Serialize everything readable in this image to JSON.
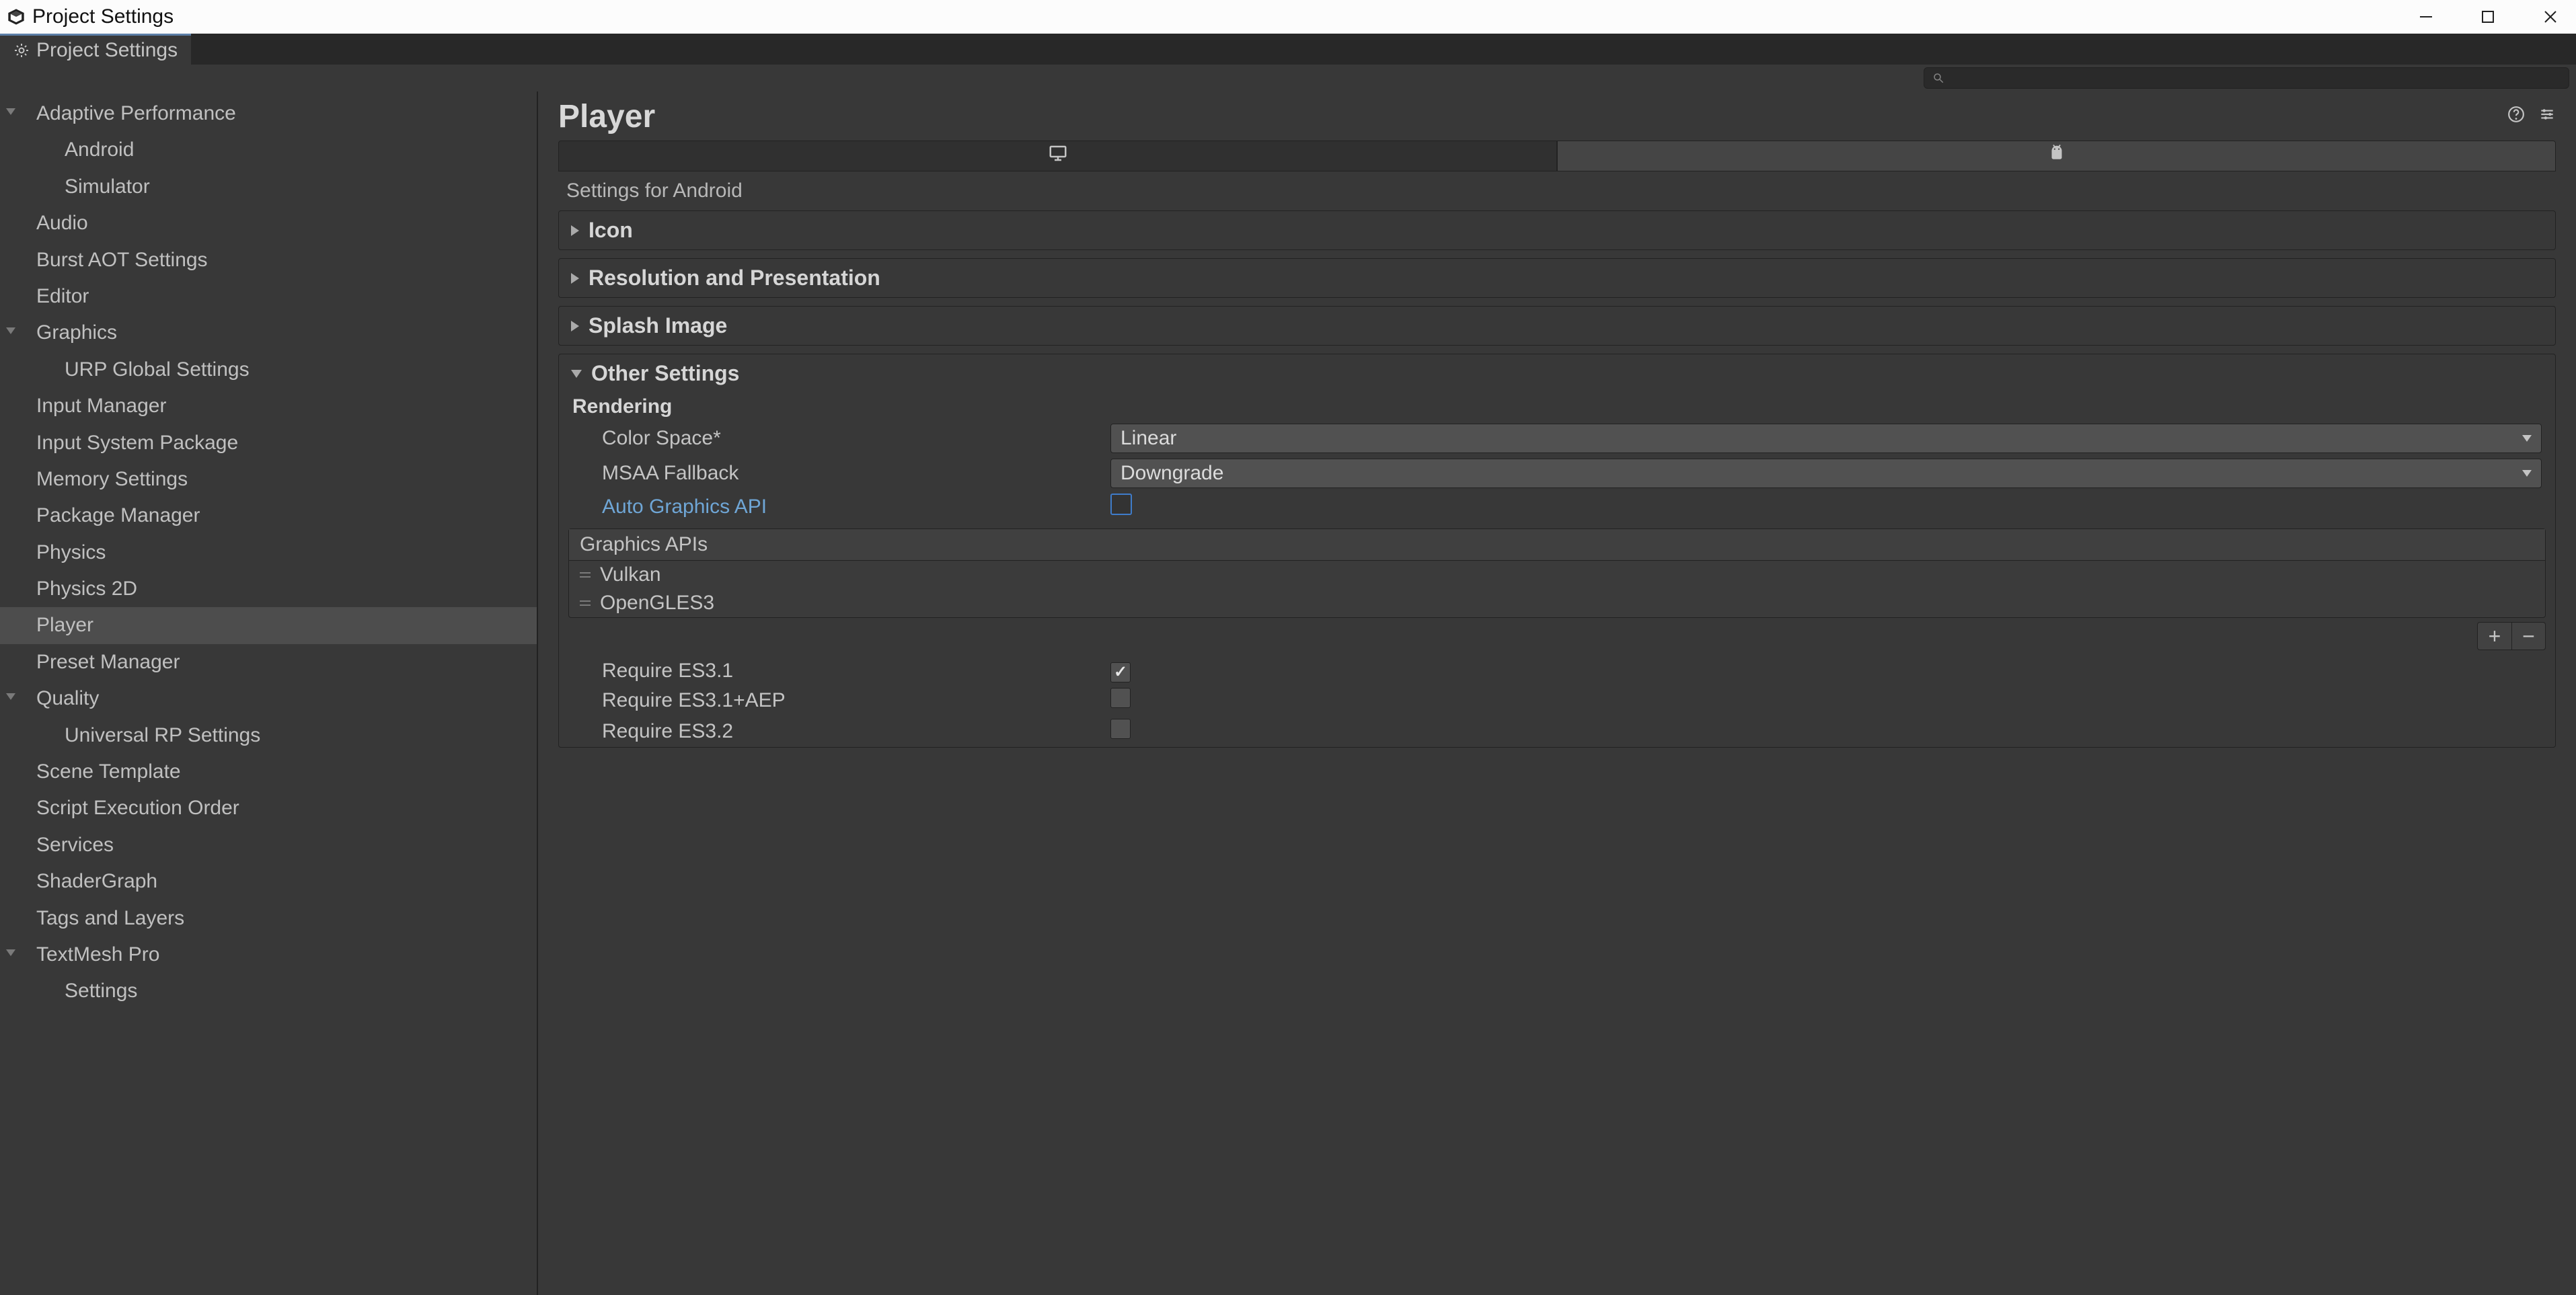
{
  "window": {
    "title": "Project Settings"
  },
  "tab": {
    "title": "Project Settings"
  },
  "sidebar": {
    "items": [
      {
        "label": "Adaptive Performance",
        "expandable": true
      },
      {
        "label": "Android",
        "child": true
      },
      {
        "label": "Simulator",
        "child": true
      },
      {
        "label": "Audio"
      },
      {
        "label": "Burst AOT Settings"
      },
      {
        "label": "Editor"
      },
      {
        "label": "Graphics",
        "expandable": true
      },
      {
        "label": "URP Global Settings",
        "child": true
      },
      {
        "label": "Input Manager"
      },
      {
        "label": "Input System Package"
      },
      {
        "label": "Memory Settings"
      },
      {
        "label": "Package Manager"
      },
      {
        "label": "Physics"
      },
      {
        "label": "Physics 2D"
      },
      {
        "label": "Player",
        "selected": true
      },
      {
        "label": "Preset Manager"
      },
      {
        "label": "Quality",
        "expandable": true
      },
      {
        "label": "Universal RP Settings",
        "child": true
      },
      {
        "label": "Scene Template"
      },
      {
        "label": "Script Execution Order"
      },
      {
        "label": "Services"
      },
      {
        "label": "ShaderGraph"
      },
      {
        "label": "Tags and Layers"
      },
      {
        "label": "TextMesh Pro",
        "expandable": true
      },
      {
        "label": "Settings",
        "child": true
      }
    ]
  },
  "content": {
    "title": "Player",
    "platformSubtitle": "Settings for Android",
    "groups": {
      "icon": "Icon",
      "resolution": "Resolution and Presentation",
      "splash": "Splash Image",
      "other": "Other Settings"
    },
    "rendering": {
      "header": "Rendering",
      "colorSpaceLabel": "Color Space*",
      "colorSpaceValue": "Linear",
      "msaaLabel": "MSAA Fallback",
      "msaaValue": "Downgrade",
      "autoApiLabel": "Auto Graphics API",
      "listHeader": "Graphics APIs",
      "apis": [
        "Vulkan",
        "OpenGLES3"
      ],
      "es31": "Require ES3.1",
      "es31aep": "Require ES3.1+AEP",
      "es32": "Require ES3.2"
    }
  }
}
